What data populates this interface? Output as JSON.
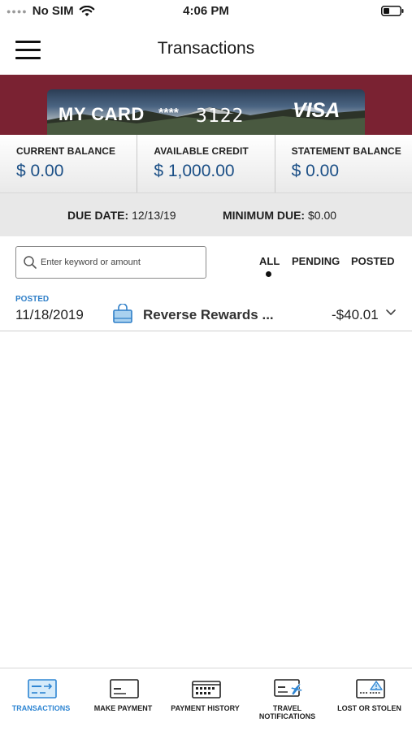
{
  "status_bar": {
    "carrier": "No SIM",
    "time": "4:06 PM"
  },
  "header": {
    "title": "Transactions"
  },
  "card": {
    "name": "MY CARD",
    "mask": "****",
    "last4": "3122",
    "brand": "VISA",
    "banner_color": "#7a2232"
  },
  "balances": [
    {
      "label": "CURRENT BALANCE",
      "value": "$ 0.00"
    },
    {
      "label": "AVAILABLE CREDIT",
      "value": "$ 1,000.00"
    },
    {
      "label": "STATEMENT BALANCE",
      "value": "$ 0.00"
    }
  ],
  "due": {
    "due_date_label": "DUE DATE:",
    "due_date_value": "12/13/19",
    "min_due_label": "MINIMUM DUE:",
    "min_due_value": "$0.00"
  },
  "search": {
    "placeholder": "Enter keyword or amount",
    "value": ""
  },
  "filters": {
    "all": "ALL",
    "pending": "PENDING",
    "posted": "POSTED",
    "selected": "ALL"
  },
  "transactions": [
    {
      "status": "POSTED",
      "date": "11/18/2019",
      "icon": "shopping-bag-icon",
      "merchant": "Reverse Rewards ...",
      "amount": "-$40.01"
    }
  ],
  "tab_bar": {
    "accent_color": "#2f86d3",
    "tabs": [
      {
        "label": "TRANSACTIONS",
        "icon": "card-transactions-icon",
        "active": true
      },
      {
        "label": "MAKE PAYMENT",
        "icon": "card-payment-icon",
        "active": false
      },
      {
        "label": "PAYMENT HISTORY",
        "icon": "calendar-card-icon",
        "active": false
      },
      {
        "label": "TRAVEL NOTIFICATIONS",
        "icon": "airplane-card-icon",
        "active": false
      },
      {
        "label": "LOST OR STOLEN",
        "icon": "warning-card-icon",
        "active": false
      }
    ]
  }
}
